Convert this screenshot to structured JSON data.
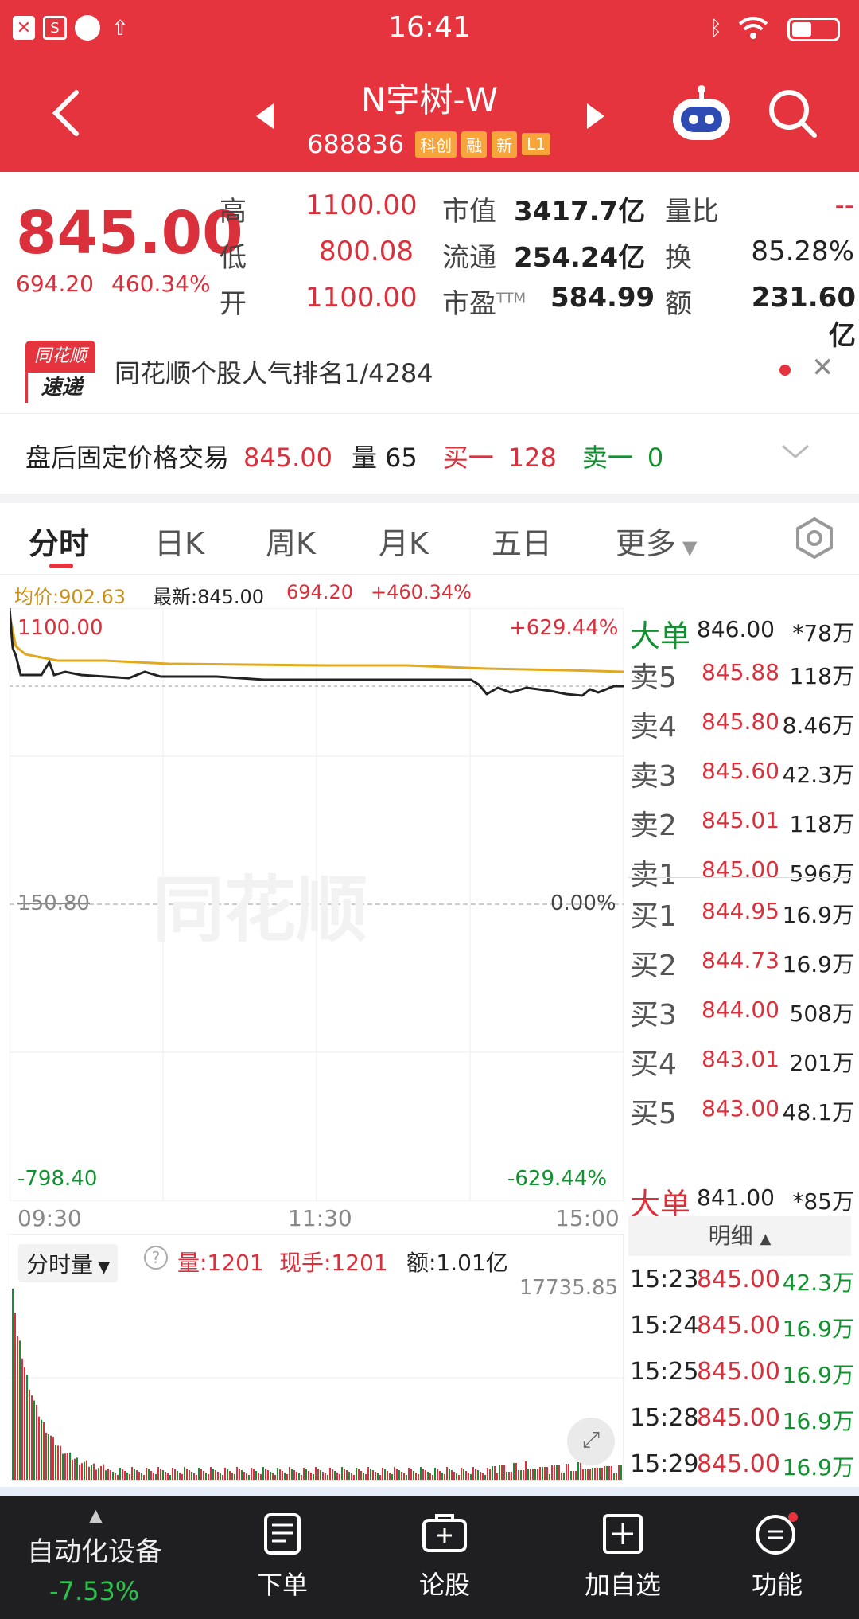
{
  "statusbar": {
    "time": "16:41"
  },
  "header": {
    "title": "N宇树-W",
    "code": "688836",
    "tags": [
      "科创",
      "融",
      "新",
      "L1"
    ]
  },
  "quote": {
    "price": "845.00",
    "change": "694.20",
    "change_pct": "460.34%",
    "high_label": "高",
    "high": "1100.00",
    "low_label": "低",
    "low": "800.08",
    "open_label": "开",
    "open": "1100.00",
    "mktcap_label": "市值",
    "mktcap": "3417.7亿",
    "float_label": "流通",
    "float": "254.24亿",
    "pe_label": "市盈",
    "pe_sup": "TTM",
    "pe": "584.99",
    "vr_label": "量比",
    "vr": "--",
    "turnover_label": "换",
    "turnover": "85.28%",
    "amount_label": "额",
    "amount": "231.60亿"
  },
  "news": {
    "badge_top": "同花顺",
    "badge_bottom": "速递",
    "text": "同花顺个股人气排名1/4284"
  },
  "afterhours": {
    "label": "盘后固定价格交易",
    "price": "845.00",
    "vol_label": "量",
    "vol": "65",
    "buy_label": "买一",
    "buy": "128",
    "sell_label": "卖一",
    "sell": "0"
  },
  "tabs": [
    "分时",
    "日K",
    "周K",
    "月K",
    "五日",
    "更多"
  ],
  "chart_info": {
    "avg": "均价:902.63",
    "last": "最新:845.00",
    "chg": "694.20",
    "pct": "+460.34%"
  },
  "chart": {
    "top_left": "1100.00",
    "top_right": "+629.44%",
    "mid_left": "150.80",
    "mid_right": "0.00%",
    "bot_left": "-798.40",
    "bot_right": "-629.44%",
    "time_start": "09:30",
    "time_mid": "11:30",
    "time_end": "15:00",
    "watermark": "同花顺"
  },
  "volume_info": {
    "selector": "分时量",
    "vol": "量:1201",
    "cur": "现手:1201",
    "amt": "额:1.01亿",
    "max": "17735.85"
  },
  "orderbook": {
    "big_sell": {
      "label": "大单",
      "price": "846.00",
      "vol": "*78万"
    },
    "asks": [
      {
        "label": "卖5",
        "price": "845.88",
        "vol": "118万"
      },
      {
        "label": "卖4",
        "price": "845.80",
        "vol": "8.46万"
      },
      {
        "label": "卖3",
        "price": "845.60",
        "vol": "42.3万"
      },
      {
        "label": "卖2",
        "price": "845.01",
        "vol": "118万"
      },
      {
        "label": "卖1",
        "price": "845.00",
        "vol": "596万"
      }
    ],
    "bids": [
      {
        "label": "买1",
        "price": "844.95",
        "vol": "16.9万"
      },
      {
        "label": "买2",
        "price": "844.73",
        "vol": "16.9万"
      },
      {
        "label": "买3",
        "price": "844.00",
        "vol": "508万"
      },
      {
        "label": "买4",
        "price": "843.01",
        "vol": "201万"
      },
      {
        "label": "买5",
        "price": "843.00",
        "vol": "48.1万"
      }
    ],
    "big_buy": {
      "label": "大单",
      "price": "841.00",
      "vol": "*85万"
    },
    "detail_label": "明细",
    "trades": [
      {
        "time": "15:23",
        "price": "845.00",
        "vol": "42.3万"
      },
      {
        "time": "15:24",
        "price": "845.00",
        "vol": "16.9万"
      },
      {
        "time": "15:25",
        "price": "845.00",
        "vol": "16.9万"
      },
      {
        "time": "15:28",
        "price": "845.00",
        "vol": "16.9万"
      },
      {
        "time": "15:29",
        "price": "845.00",
        "vol": "16.9万"
      }
    ]
  },
  "navbar": {
    "sector": "自动化设备",
    "sector_pct": "-7.53%",
    "items": [
      "下单",
      "论股",
      "加自选",
      "功能"
    ]
  },
  "colors": {
    "brand": "#e5343d",
    "up": "#d9303c",
    "down": "#11912f",
    "avg_line": "#e0a91e"
  }
}
